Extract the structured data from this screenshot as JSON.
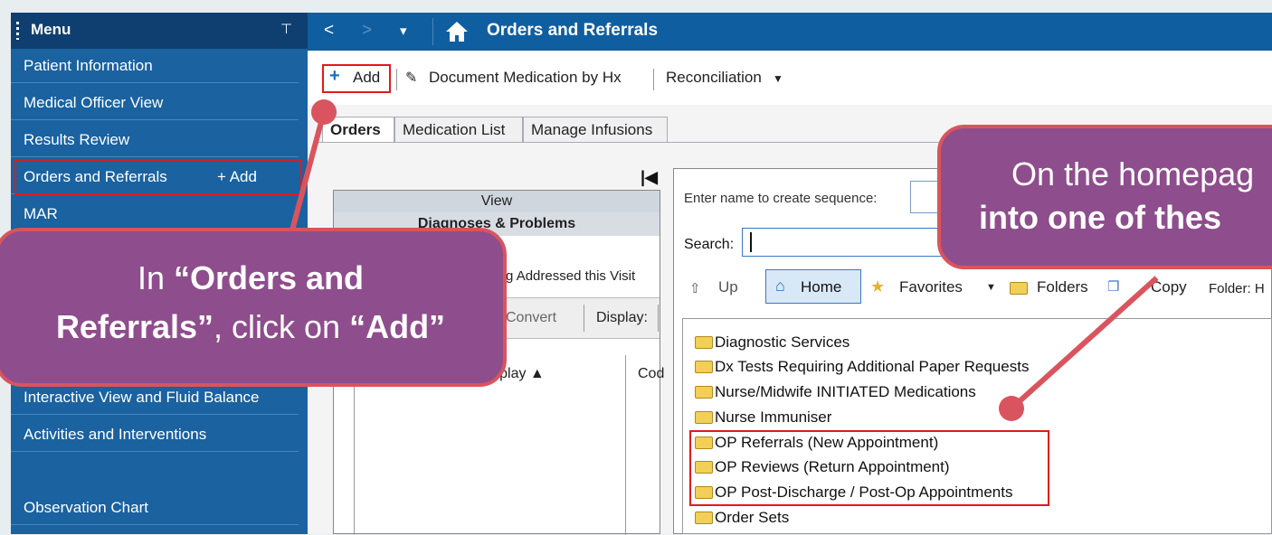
{
  "menu": {
    "title": "Menu",
    "items": [
      {
        "label": "Patient Information"
      },
      {
        "label": "Medical Officer View"
      },
      {
        "label": "Results Review"
      },
      {
        "label": "Orders and Referrals",
        "add": "+ Add"
      },
      {
        "label": "MAR"
      },
      {
        "label": "Interactive View and Fluid Balance"
      },
      {
        "label": "Activities and Interventions"
      },
      {
        "label": "Observation Chart"
      }
    ]
  },
  "topbar": {
    "title": "Orders and Referrals",
    "back": "<",
    "forward": ">",
    "dropdown": "▾"
  },
  "toolbar": {
    "add": "Add",
    "document_med": "Document Medication by Hx",
    "reconciliation": "Reconciliation"
  },
  "tabs": [
    "Orders",
    "Medication List",
    "Manage Infusions"
  ],
  "left_panel": {
    "view": "View",
    "section": "Diagnoses & Problems",
    "addressed": "Being Addressed this Visit",
    "convert": "Convert",
    "display": "Display:",
    "col_display": "Display",
    "col_code": "Cod"
  },
  "right_panel": {
    "sequence_label": "Enter name to create sequence:",
    "search_label": "Search:",
    "nav": {
      "up": "Up",
      "home": "Home",
      "favorites": "Favorites",
      "folders": "Folders",
      "copy": "Copy",
      "folder": "Folder: H"
    },
    "folders": [
      "Diagnostic Services",
      "Dx Tests Requiring Additional Paper Requests",
      "Nurse/Midwife INITIATED Medications",
      "Nurse Immuniser",
      "OP Referrals (New Appointment)",
      "OP Reviews (Return Appointment)",
      "OP Post-Discharge / Post-Op Appointments",
      "Order Sets"
    ]
  },
  "callout_left": {
    "l1a": "In ",
    "l1b": "“Orders and",
    "l2a": "Referrals”",
    "l2b": ", click on ",
    "l2c": "“Add”"
  },
  "callout_right": {
    "l1": "On the homepag",
    "l2": "into one of thes"
  },
  "colors": {
    "accent_red": "#e01a1a",
    "callout_fill": "#8e4d8c",
    "callout_border": "#d9545e",
    "menu_blue": "#1a62a0",
    "topbar_blue": "#0f5ea0"
  }
}
